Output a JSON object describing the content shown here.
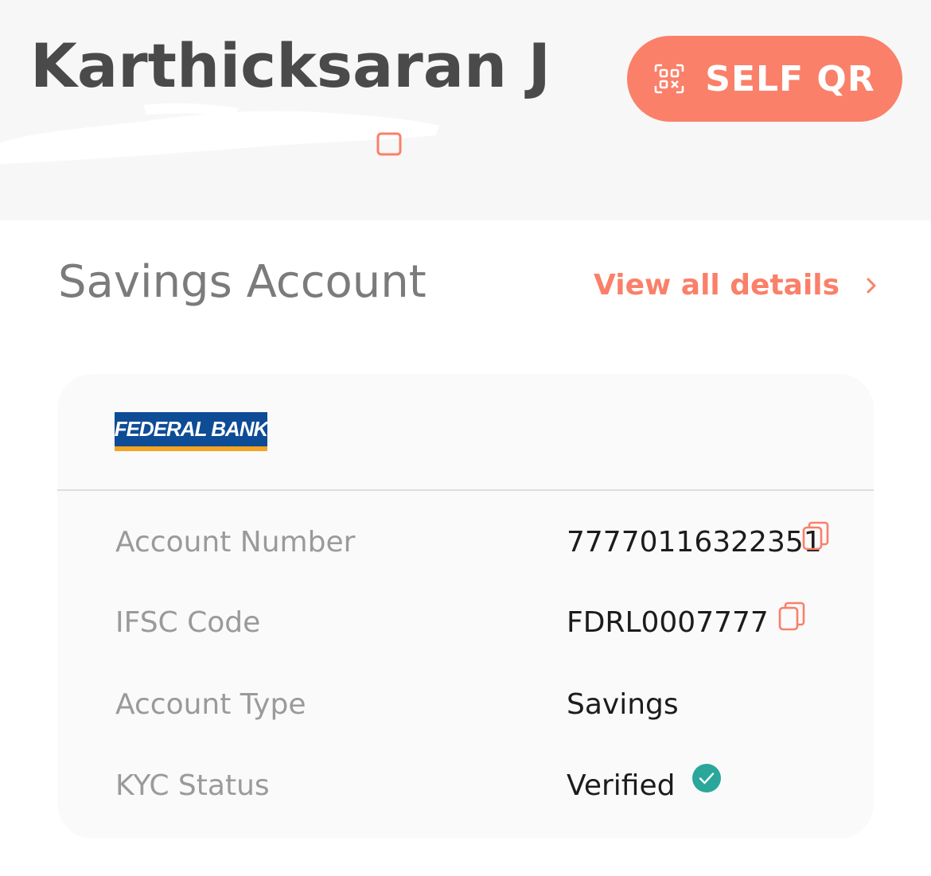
{
  "header": {
    "user_name": "Karthicksaran J",
    "self_qr_label": "SELF QR"
  },
  "account": {
    "section_title": "Savings Account",
    "view_all_label": "View all details",
    "bank_logo_text": "FEDERAL BANK",
    "rows": [
      {
        "label": "Account Number",
        "value": "77770116322351",
        "icon": "copy-icon"
      },
      {
        "label": "IFSC Code",
        "value": "FDRL0007777",
        "icon": "copy-icon"
      },
      {
        "label": "Account Type",
        "value": "Savings",
        "icon": ""
      },
      {
        "label": "KYC Status",
        "value": "Verified",
        "icon": "check-circle-icon"
      }
    ]
  },
  "colors": {
    "accent": "#fa8069",
    "header_bg": "#f7f7f7",
    "card_bg": "#fafafa",
    "verified": "#2aa79a",
    "bank_blue": "#0e4c96",
    "bank_stripe": "#f2a422"
  }
}
